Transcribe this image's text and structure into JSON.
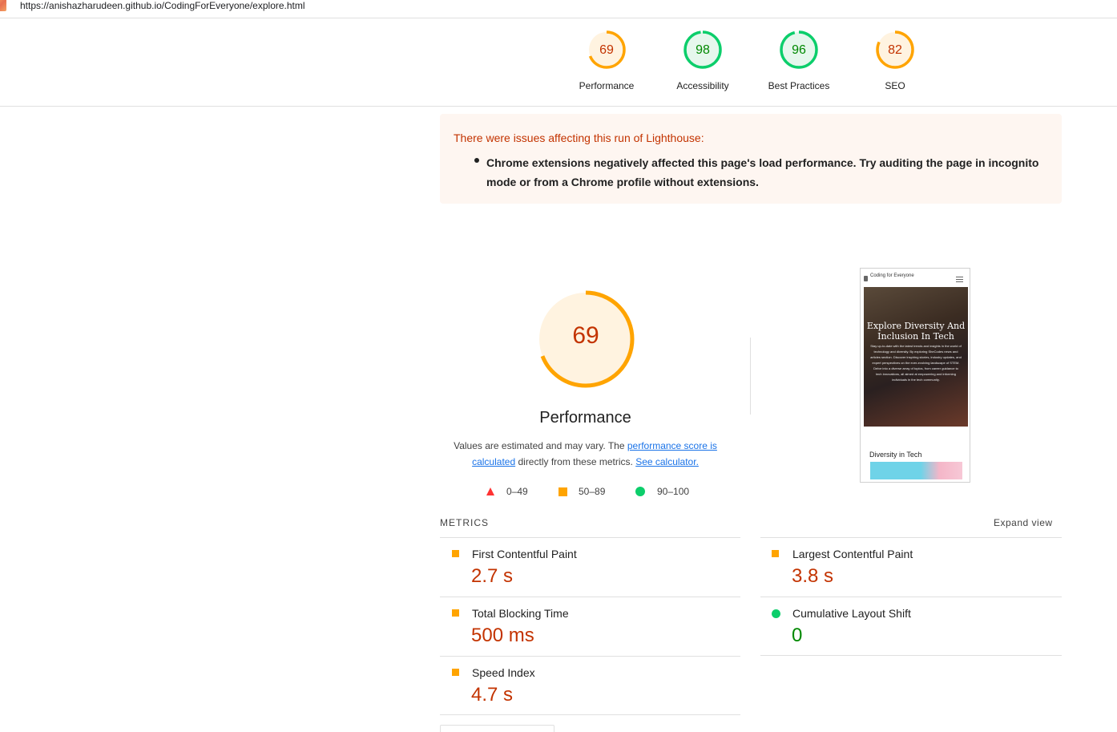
{
  "url": "https://anishazharudeen.github.io/CodingForEveryone/explore.html",
  "categories": [
    {
      "label": "Performance",
      "score": "69",
      "color": "#ffa400",
      "text_color": "#c33300",
      "bg": "#fff3e0"
    },
    {
      "label": "Accessibility",
      "score": "98",
      "color": "#0cce6b",
      "text_color": "#008800",
      "bg": "#e6f7ed"
    },
    {
      "label": "Best Practices",
      "score": "96",
      "color": "#0cce6b",
      "text_color": "#008800",
      "bg": "#e6f7ed"
    },
    {
      "label": "SEO",
      "score": "82",
      "color": "#ffa400",
      "text_color": "#c33300",
      "bg": "#fff3e0"
    }
  ],
  "warning": {
    "title": "There were issues affecting this run of Lighthouse:",
    "item": "Chrome extensions negatively affected this page's load performance. Try auditing the page in incognito mode or from a Chrome profile without extensions."
  },
  "performance": {
    "score": "69",
    "title": "Performance",
    "desc_part1": "Values are estimated and may vary. The ",
    "link1": "performance score is calculated",
    "desc_part2": " directly from these metrics. ",
    "link2": "See calculator."
  },
  "legend": [
    {
      "icon": "triangle-red-icon",
      "label": "0–49"
    },
    {
      "icon": "square-orange-icon",
      "label": "50–89"
    },
    {
      "icon": "circle-green-icon",
      "label": "90–100"
    }
  ],
  "screenshot": {
    "nav_title": "Coding for Everyone",
    "hero_title": "Explore Diversity And Inclusion In Tech",
    "hero_text": "Stay up-to-date with the latest trends and insights in the world of technology and diversity. By exploring SheCodes news and articles section. Discover inspiring stories, industry updates, and expert perspectives on the ever-evolving landscape of STEM. Delve into a diverse array of topics, from career guidance to tech innovations, all aimed at empowering and informing individuals in the tech community.",
    "section_title": "Diversity in Tech"
  },
  "metrics": {
    "label": "METRICS",
    "expand": "Expand view",
    "items": [
      {
        "name": "First Contentful Paint",
        "value": "2.7 s",
        "status": "average"
      },
      {
        "name": "Largest Contentful Paint",
        "value": "3.8 s",
        "status": "average"
      },
      {
        "name": "Total Blocking Time",
        "value": "500 ms",
        "status": "average"
      },
      {
        "name": "Cumulative Layout Shift",
        "value": "0",
        "status": "pass"
      },
      {
        "name": "Speed Index",
        "value": "4.7 s",
        "status": "average"
      }
    ]
  }
}
